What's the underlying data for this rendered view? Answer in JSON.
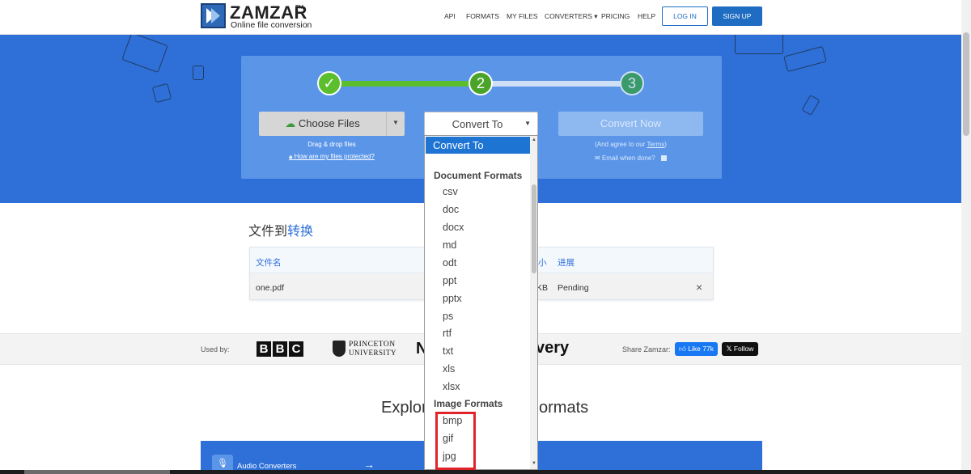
{
  "header": {
    "brand": "ZAMZAR",
    "tm": "TM",
    "tagline": "Online file conversion",
    "nav": [
      "API",
      "FORMATS",
      "MY FILES",
      "CONVERTERS ▾",
      "PRICING",
      "HELP"
    ],
    "login": "LOG IN",
    "signup": "SIGN UP"
  },
  "steps": {
    "step1_mark": "✓",
    "step2": "2",
    "step3": "3",
    "colors": {
      "done": "#5cbe2c",
      "active": "#4aa42a",
      "pending": "#3a9a6a"
    }
  },
  "upload": {
    "choose_files": "Choose Files",
    "drag_drop": "Drag & drop files",
    "protected_link": "How are my files protected?"
  },
  "convert_to": {
    "label": "Convert To"
  },
  "convert_now": {
    "label": "Convert Now",
    "agree_prefix": "(And agree to our ",
    "agree_link": "Terms",
    "agree_suffix": ")",
    "email_when_done": "Email when done?"
  },
  "files": {
    "title_part1": "文件到",
    "title_part2": "转换",
    "columns": {
      "name": "文件名",
      "size_tail": "小",
      "progress": "进展"
    },
    "row": {
      "name": "one.pdf",
      "size_tail": "KB",
      "status": "Pending",
      "remove": "×"
    }
  },
  "used_by": {
    "label": "Used by:",
    "bbc_letters": [
      "B",
      "B",
      "C"
    ],
    "princeton_line1": "PRINCETON",
    "princeton_line2": "UNIVERSITY",
    "partial_logo_left": "N",
    "partial_logo_right": "very"
  },
  "share": {
    "label": "Share Zamzar:",
    "like": "Like 77k",
    "follow": "Follow"
  },
  "explore": {
    "left": "Explor",
    "right": "ormats"
  },
  "audio": {
    "label": "Audio Converters",
    "arrow": "→"
  },
  "dropdown": {
    "selected": "Convert To",
    "document_heading": "Document Formats",
    "document_formats": [
      "csv",
      "doc",
      "docx",
      "md",
      "odt",
      "ppt",
      "pptx",
      "ps",
      "rtf",
      "txt",
      "xls",
      "xlsx"
    ],
    "image_heading": "Image Formats",
    "image_formats": [
      "bmp",
      "gif",
      "jpg"
    ]
  },
  "colors": {
    "brand_blue": "#2e6fd8",
    "highlight": "#e0242a"
  }
}
